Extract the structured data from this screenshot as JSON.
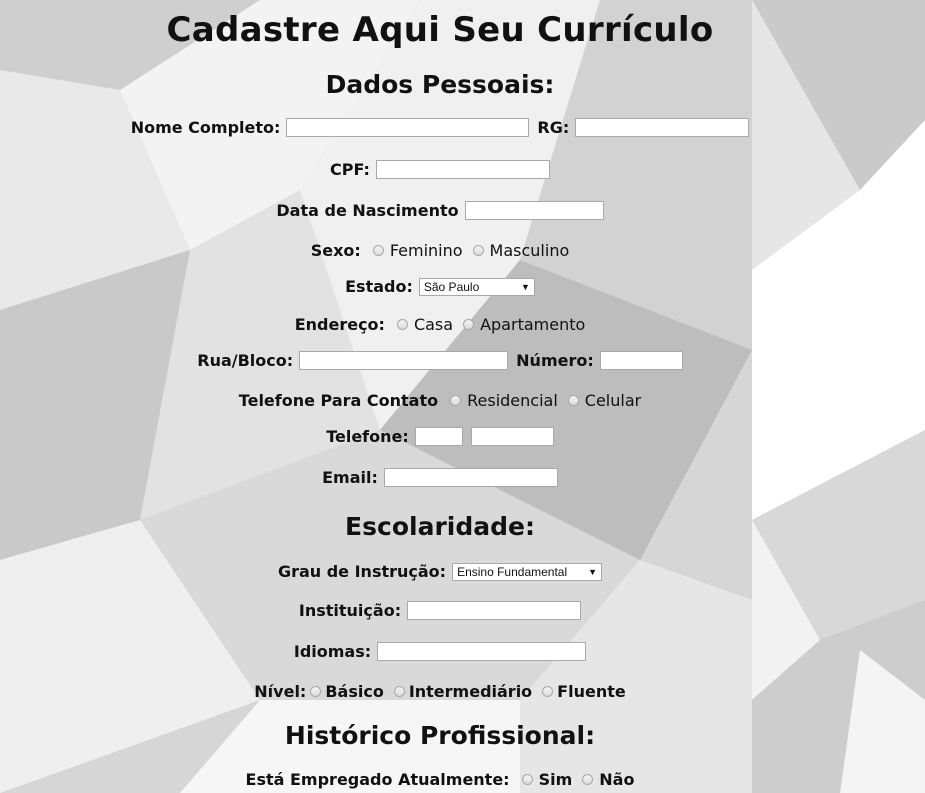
{
  "title": "Cadastre Aqui Seu Currículo",
  "sections": {
    "personal": "Dados Pessoais:",
    "education": "Escolaridade:",
    "history": "Histórico Profissional:"
  },
  "fields": {
    "nome_label": "Nome Completo:",
    "rg_label": "RG:",
    "cpf_label": "CPF:",
    "nascimento_label": "Data de Nascimento",
    "sexo_label": "Sexo:",
    "sexo_options": [
      "Feminino",
      "Masculino"
    ],
    "estado_label": "Estado:",
    "estado_value": "São Paulo",
    "endereco_label": "Endereço:",
    "endereco_options": [
      "Casa",
      "Apartamento"
    ],
    "rua_label": "Rua/Bloco:",
    "numero_label": "Número:",
    "contato_label": "Telefone Para Contato",
    "contato_options": [
      "Residencial",
      "Celular"
    ],
    "telefone_label": "Telefone:",
    "email_label": "Email:",
    "grau_label": "Grau de Instrução:",
    "grau_value": "Ensino Fundamental",
    "instituicao_label": "Instituição:",
    "idiomas_label": "Idiomas:",
    "nivel_label": "Nível:",
    "nivel_options": [
      "Básico",
      "Intermediário",
      "Fluente"
    ],
    "empregado_label": "Está Empregado Atualmente:",
    "empregado_options": [
      "Sim",
      "Não"
    ]
  }
}
